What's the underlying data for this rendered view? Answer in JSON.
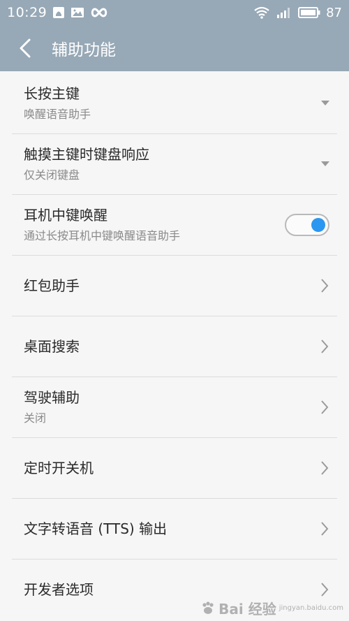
{
  "status_bar": {
    "time": "10:29",
    "battery_percent": "87",
    "icons": [
      "notification-icon",
      "gallery-icon",
      "infinity-icon",
      "wifi-icon",
      "signal-icon",
      "battery-icon"
    ]
  },
  "header": {
    "title": "辅助功能",
    "back_icon": "chevron-left-icon"
  },
  "settings": {
    "items": [
      {
        "title": "长按主键",
        "subtitle": "唤醒语音助手",
        "trailing": "dropdown"
      },
      {
        "title": "触摸主键时键盘响应",
        "subtitle": "仅关闭键盘",
        "trailing": "dropdown"
      },
      {
        "title": "耳机中键唤醒",
        "subtitle": "通过长按耳机中键唤醒语音助手",
        "trailing": "toggle",
        "toggle_on": true
      },
      {
        "title": "红包助手",
        "subtitle": "",
        "trailing": "chevron"
      },
      {
        "title": "桌面搜索",
        "subtitle": "",
        "trailing": "chevron"
      },
      {
        "title": "驾驶辅助",
        "subtitle": "关闭",
        "trailing": "chevron"
      },
      {
        "title": "定时开关机",
        "subtitle": "",
        "trailing": "chevron"
      },
      {
        "title": "文字转语音 (TTS) 输出",
        "subtitle": "",
        "trailing": "chevron"
      },
      {
        "title": "开发者选项",
        "subtitle": "",
        "trailing": "chevron"
      }
    ]
  },
  "colors": {
    "header_bg": "#97a8b6",
    "toggle_accent": "#2b97f0",
    "divider": "#dcdcdc"
  },
  "watermark": {
    "text": "Bai 经验",
    "url": "jingyan.baidu.com"
  }
}
